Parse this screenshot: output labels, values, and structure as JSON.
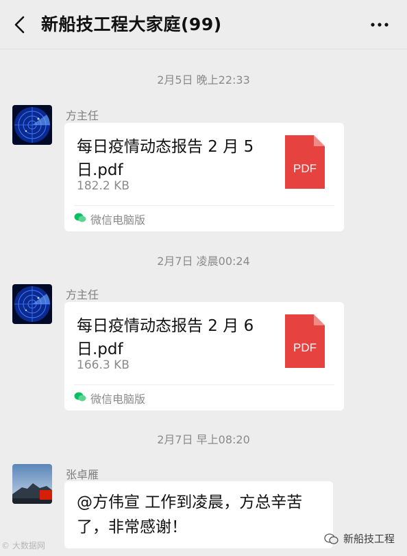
{
  "header": {
    "title": "新船技工程大家庭(99)"
  },
  "messages": [
    {
      "timestamp": "2月5日 晚上22:33",
      "sender": "方主任",
      "file_name": "每日疫情动态报告 2 月 5 日.pdf",
      "file_size": "182.2 KB",
      "file_type": "PDF",
      "source": "微信电脑版"
    },
    {
      "timestamp": "2月7日 凌晨00:24",
      "sender": "方主任",
      "file_name": "每日疫情动态报告 2 月 6 日.pdf",
      "file_size": "166.3 KB",
      "file_type": "PDF",
      "source": "微信电脑版"
    },
    {
      "timestamp": "2月7日 早上08:20",
      "sender": "张卓雁",
      "text": "@方伟宣 工作到凌晨，方总辛苦了，非常感谢！"
    }
  ],
  "watermarks": {
    "left": "大数据网",
    "right": "新船技工程"
  },
  "colors": {
    "background": "#ededed",
    "bubble": "#ffffff",
    "pdf_red": "#e64340",
    "wechat_green": "#07c160"
  }
}
